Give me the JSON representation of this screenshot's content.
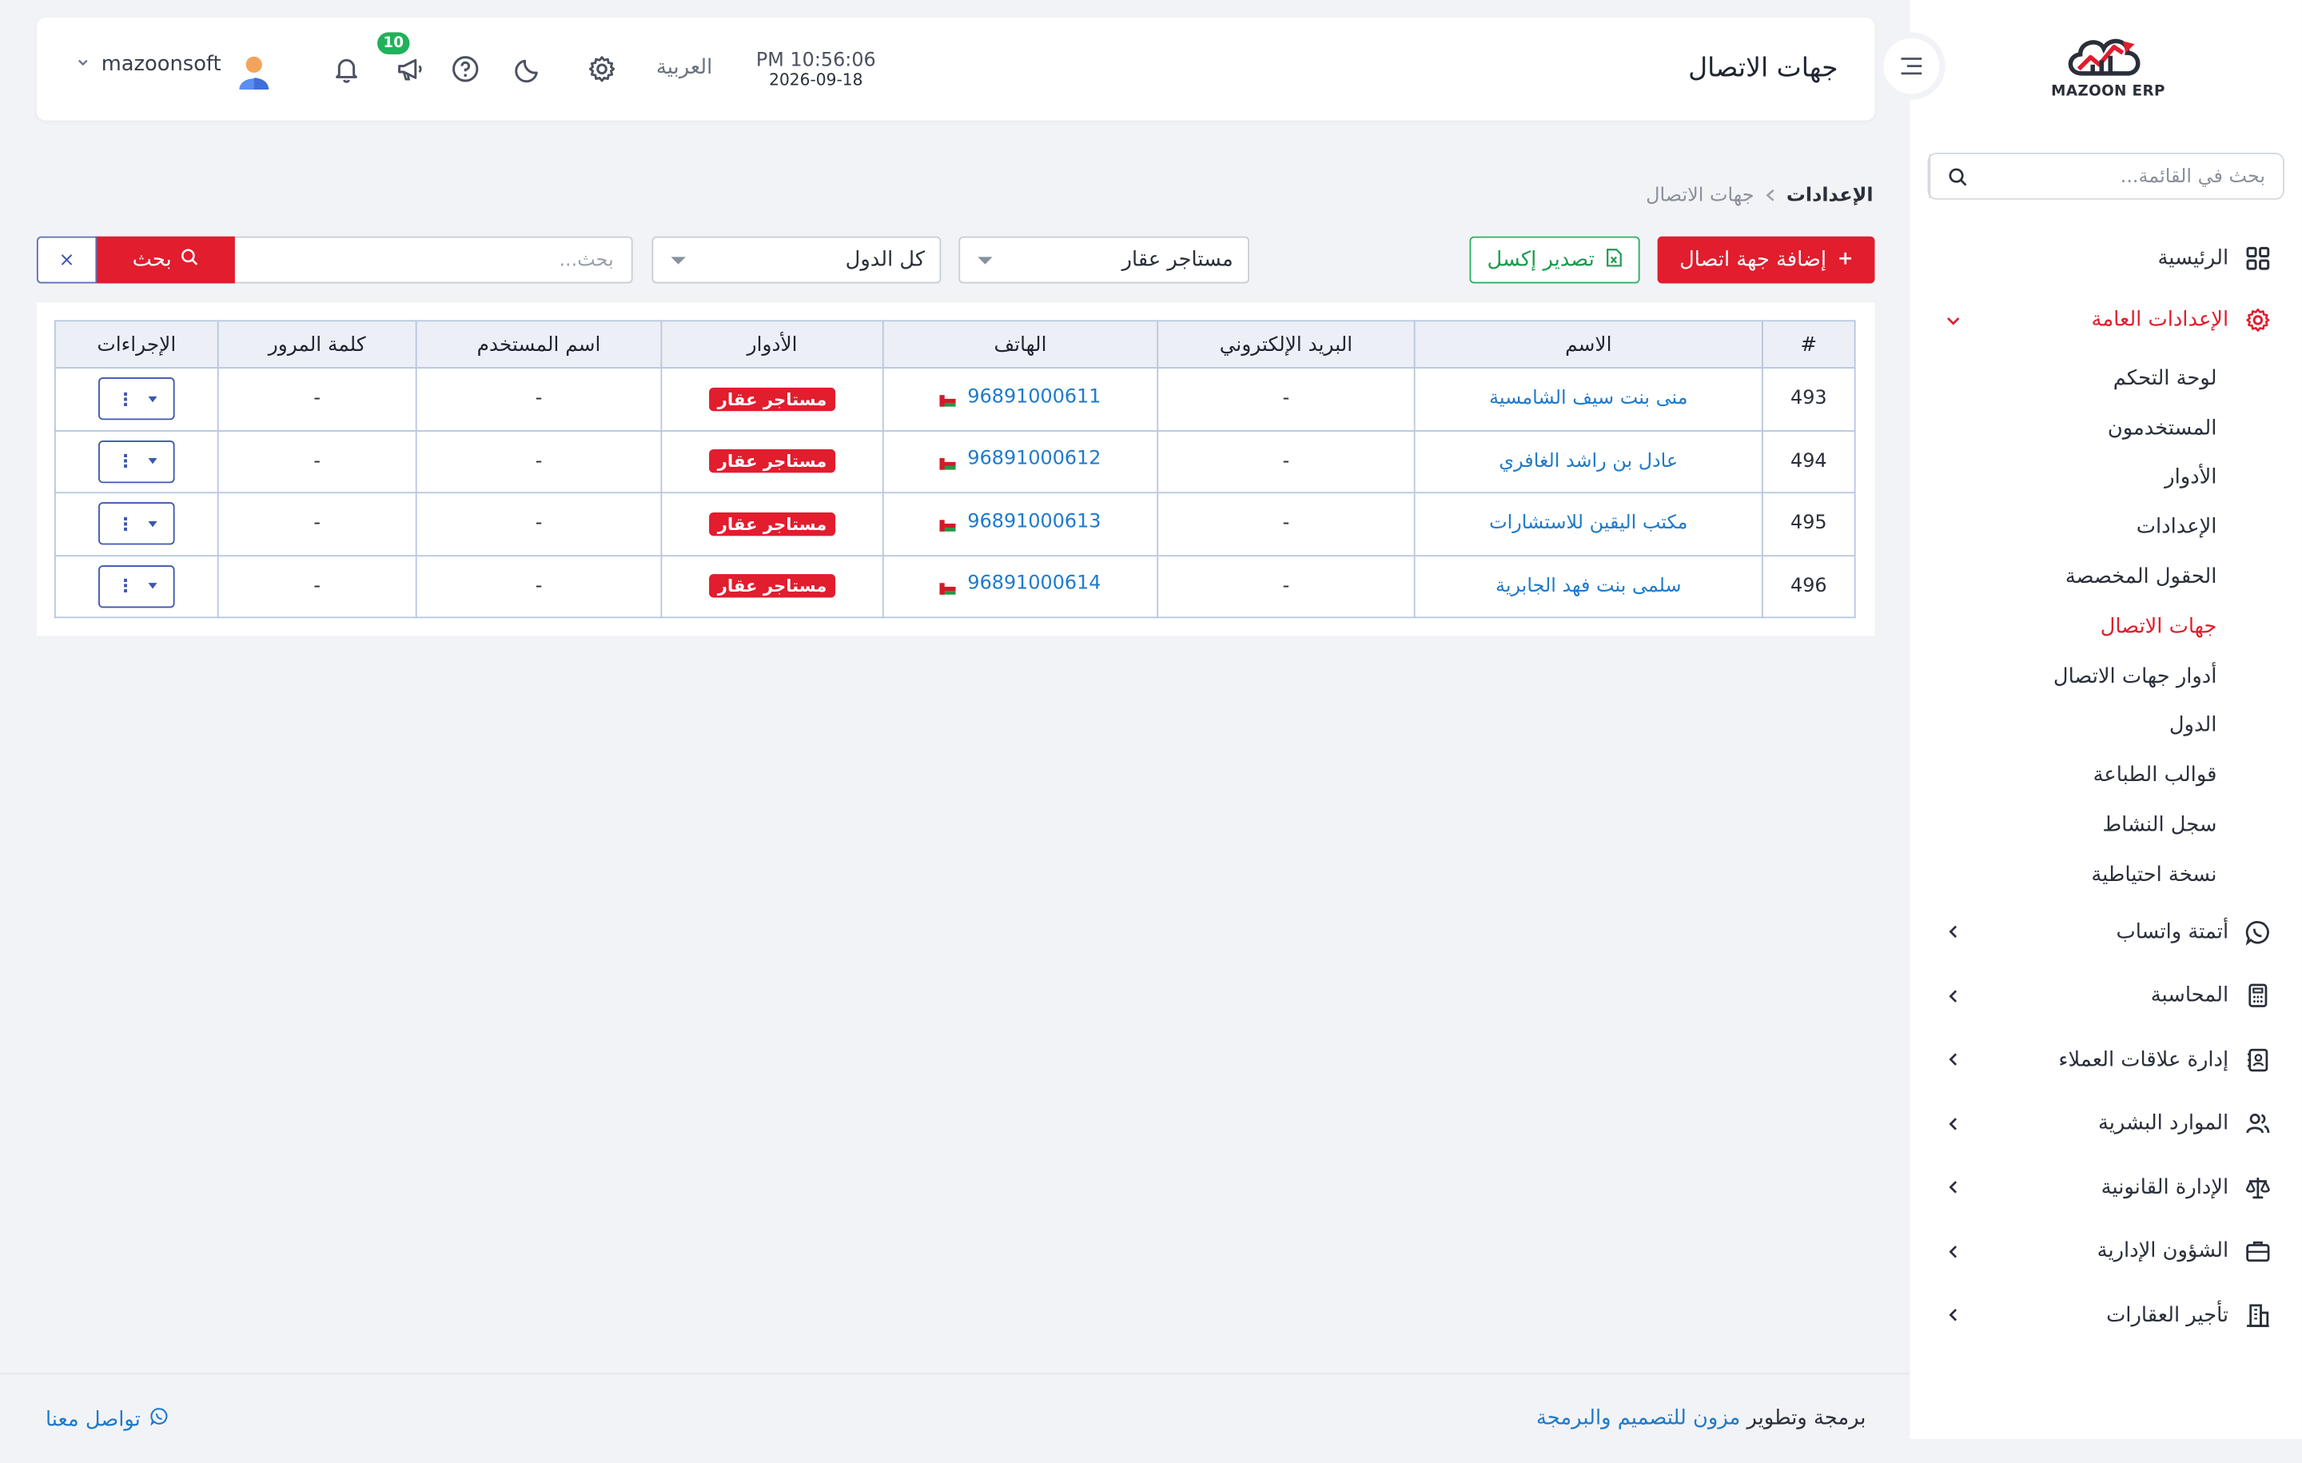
{
  "brand": {
    "logo_text": "MAZOON ERP",
    "accent": "#e11d2e",
    "link": "#1f7acb"
  },
  "header": {
    "page_title": "جهات الاتصال",
    "username": "mazoonsoft",
    "notification_count": "10",
    "language": "العربية",
    "time": "PM 10:56:06",
    "date": "2026-09-18"
  },
  "sidebar": {
    "search_placeholder": "بحث في القائمة...",
    "home": "الرئيسية",
    "general_settings": "الإعدادات العامة",
    "sub_items": [
      "لوحة التحكم",
      "المستخدمون",
      "الأدوار",
      "الإعدادات",
      "الحقول المخصصة",
      "جهات الاتصال",
      "أدوار جهات الاتصال",
      "الدول",
      "قوالب الطباعة",
      "سجل النشاط",
      "نسخة احتياطية"
    ],
    "groups": [
      {
        "label": "أتمتة واتساب",
        "icon": "whatsapp-icon"
      },
      {
        "label": "المحاسبة",
        "icon": "calculator-icon"
      },
      {
        "label": "إدارة علاقات العملاء",
        "icon": "contacts-book-icon"
      },
      {
        "label": "الموارد البشرية",
        "icon": "users-icon"
      },
      {
        "label": "الإدارة القانونية",
        "icon": "scale-icon"
      },
      {
        "label": "الشؤون الإدارية",
        "icon": "briefcase-icon"
      },
      {
        "label": "تأجير العقارات",
        "icon": "building-icon"
      }
    ]
  },
  "breadcrumb": {
    "parent": "الإعدادات",
    "current": "جهات الاتصال"
  },
  "toolbar": {
    "add_label": "إضافة جهة اتصال",
    "export_label": "تصدير إكسل",
    "role_filter": "مستاجر عقار",
    "country_filter": "كل الدول",
    "search_placeholder": "بحث...",
    "search_label": "بحث",
    "clear_label": "×"
  },
  "table": {
    "headers": [
      "#",
      "الاسم",
      "البريد الإلكتروني",
      "الهاتف",
      "الأدوار",
      "اسم المستخدم",
      "كلمة المرور",
      "الإجراءات"
    ],
    "rows": [
      {
        "id": "493",
        "name": "منى بنت سيف الشامسية",
        "email": "-",
        "phone": "96891000611",
        "role": "مستاجر عقار",
        "username": "-",
        "password": "-"
      },
      {
        "id": "494",
        "name": "عادل بن راشد الغافري",
        "email": "-",
        "phone": "96891000612",
        "role": "مستاجر عقار",
        "username": "-",
        "password": "-"
      },
      {
        "id": "495",
        "name": "مكتب اليقين للاستشارات",
        "email": "-",
        "phone": "96891000613",
        "role": "مستاجر عقار",
        "username": "-",
        "password": "-"
      },
      {
        "id": "496",
        "name": "سلمى بنت فهد الجابرية",
        "email": "-",
        "phone": "96891000614",
        "role": "مستاجر عقار",
        "username": "-",
        "password": "-"
      }
    ]
  },
  "footer": {
    "credit_prefix": "برمجة وتطوير",
    "credit_company": "مزون للتصميم والبرمجة",
    "contact": "تواصل معنا"
  }
}
